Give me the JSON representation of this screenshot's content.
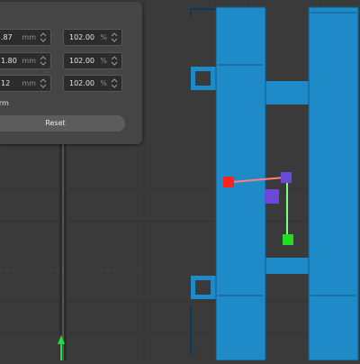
{
  "scale_panel": {
    "rows": [
      {
        "size": ".87",
        "size_unit": "mm",
        "percent": "102.00",
        "percent_unit": "%"
      },
      {
        "size": "1.80",
        "size_unit": "mm",
        "percent": "102.00",
        "percent_unit": "%"
      },
      {
        "size": "12",
        "size_unit": "mm",
        "percent": "102.00",
        "percent_unit": "%"
      }
    ],
    "transform_label": "orm",
    "reset_label": "Reset"
  },
  "colors": {
    "background": "#3a3a3a",
    "model": "#1e8ac8",
    "gizmo_x": "#ff2020",
    "gizmo_y": "#22dd22",
    "gizmo_center": "#6a48d8",
    "axis_up": "#22dd44"
  },
  "icons": [
    "spin-arrows-icon",
    "transform-gizmo-icon",
    "axis-arrow-icon"
  ]
}
